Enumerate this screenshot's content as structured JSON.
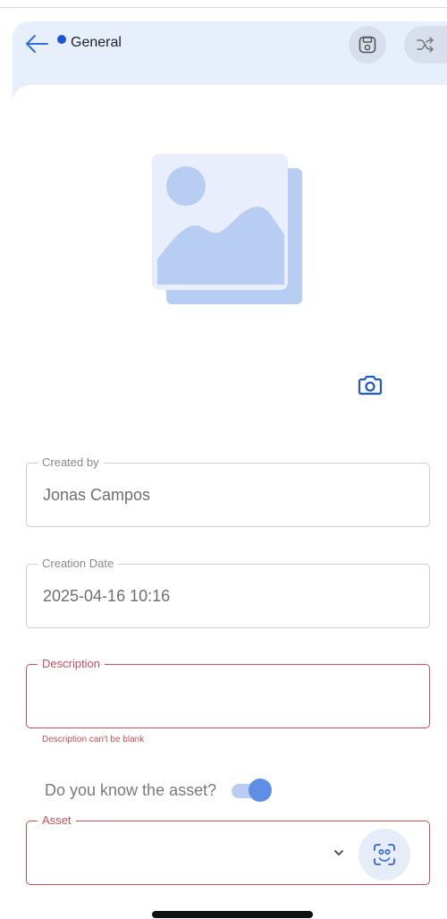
{
  "header": {
    "title": "General",
    "icons": {
      "back": "arrow-left-icon",
      "save": "floppy-disk-icon",
      "shuffle": "shuffle-icon"
    },
    "accent": "#1b57d6",
    "background": "#e7effc"
  },
  "image": {
    "icon": "image-placeholder-icon",
    "camera_icon": "camera-icon"
  },
  "fields": {
    "created_by": {
      "label": "Created by",
      "value": "Jonas Campos"
    },
    "creation_date": {
      "label": "Creation Date",
      "value": "2025-04-16 10:16"
    },
    "description": {
      "label": "Description",
      "value": "",
      "error": "Description can't be blank"
    },
    "asset": {
      "label": "Asset",
      "value": "",
      "icons": {
        "dropdown": "chevron-down-icon",
        "scan": "face-scan-icon"
      }
    }
  },
  "toggle": {
    "label": "Do you know the asset?",
    "on": true
  },
  "colors": {
    "error": "#c8505a",
    "toggle_thumb": "#5f8fe4",
    "toggle_track": "#b9cdf0"
  }
}
